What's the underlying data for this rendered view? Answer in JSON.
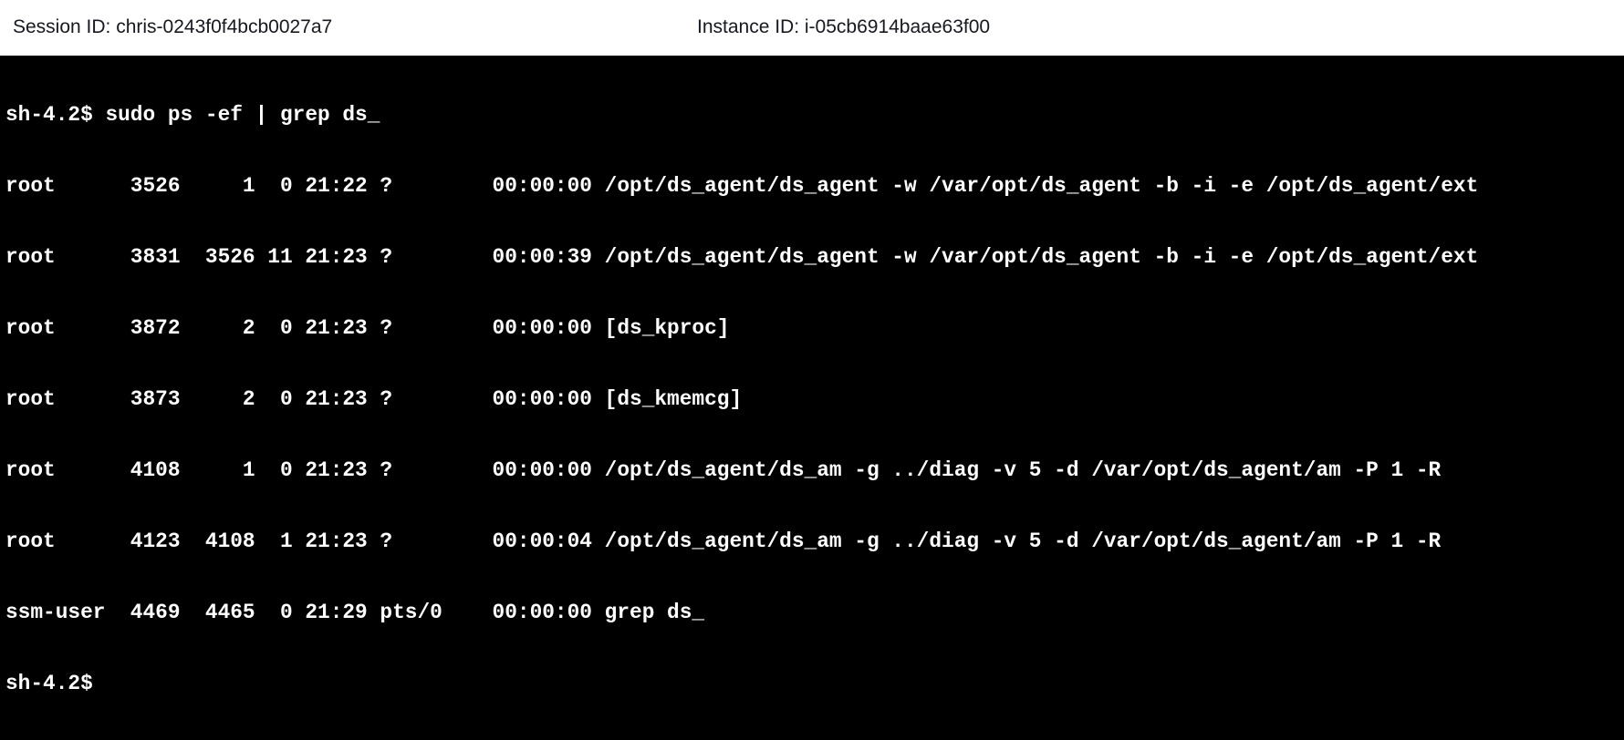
{
  "header": {
    "session_text": "Session ID: chris-0243f0f4bcb0027a7",
    "instance_text": "Instance ID: i-05cb6914baae63f00"
  },
  "terminal": {
    "colors": {
      "background": "#000000",
      "foreground": "#ffffff"
    },
    "lines": [
      "sh-4.2$ sudo ps -ef | grep ds_",
      "root      3526     1  0 21:22 ?        00:00:00 /opt/ds_agent/ds_agent -w /var/opt/ds_agent -b -i -e /opt/ds_agent/ext",
      "root      3831  3526 11 21:23 ?        00:00:39 /opt/ds_agent/ds_agent -w /var/opt/ds_agent -b -i -e /opt/ds_agent/ext",
      "root      3872     2  0 21:23 ?        00:00:00 [ds_kproc]",
      "root      3873     2  0 21:23 ?        00:00:00 [ds_kmemcg]",
      "root      4108     1  0 21:23 ?        00:00:00 /opt/ds_agent/ds_am -g ../diag -v 5 -d /var/opt/ds_agent/am -P 1 -R",
      "root      4123  4108  1 21:23 ?        00:00:04 /opt/ds_agent/ds_am -g ../diag -v 5 -d /var/opt/ds_agent/am -P 1 -R",
      "ssm-user  4469  4465  0 21:29 pts/0    00:00:00 grep ds_",
      "sh-4.2$"
    ]
  }
}
